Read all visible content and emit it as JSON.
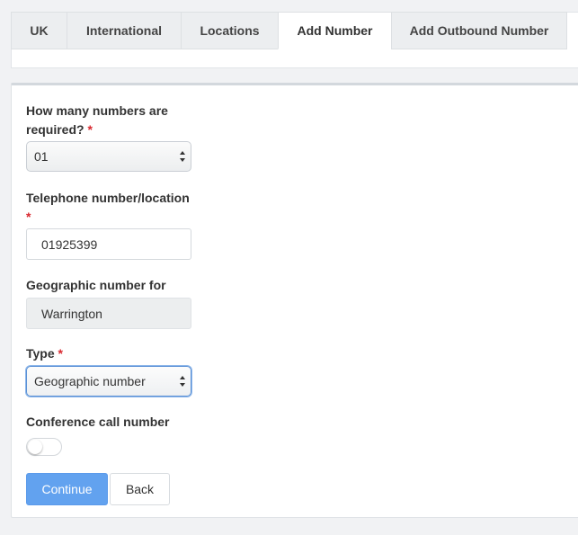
{
  "tabs": [
    {
      "label": "UK"
    },
    {
      "label": "International"
    },
    {
      "label": "Locations"
    },
    {
      "label": "Add Number"
    },
    {
      "label": "Add Outbound Number"
    }
  ],
  "active_tab": "Add Number",
  "form": {
    "quantity": {
      "label_line1": "How many numbers are",
      "label_line2": "required?",
      "required_mark": "*",
      "value": "01"
    },
    "telephone": {
      "label": "Telephone number/location",
      "required_mark": "*",
      "value": "01925399"
    },
    "geographic": {
      "label": "Geographic number for",
      "value": "Warrington"
    },
    "type": {
      "label": "Type",
      "required_mark": "*",
      "value": "Geographic number"
    },
    "conference": {
      "label": "Conference call number",
      "enabled": false
    }
  },
  "buttons": {
    "continue": "Continue",
    "back": "Back"
  },
  "colors": {
    "primary": "#62a2ef",
    "required": "#d9282f",
    "focus": "#5b91d6"
  }
}
